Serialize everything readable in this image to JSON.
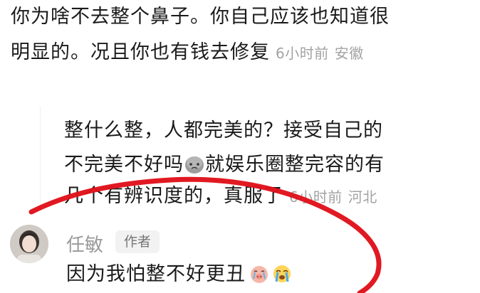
{
  "comment1": {
    "line1": "你为啥不去整个鼻子。你自己应该也知道很",
    "line2": "明显的。况且你也有钱去修复",
    "time": "6小时前",
    "location": "安徽"
  },
  "comment2": {
    "line1": "整什么整，人都完美的？接受自己的",
    "line2a": "不完美不好吗",
    "line2b": "就娱乐圈整完容的有",
    "line3": "几个有辨识度的，真服了",
    "time": "6小时前",
    "location": "河北"
  },
  "comment3": {
    "author": "任敏",
    "badge": "作者",
    "text": "因为我怕整不好更丑"
  },
  "icons": {
    "comment2_emoji": "sad-face-emoji",
    "comment3_emoji1": "crying-pig-emoji",
    "comment3_emoji2": "crying-face-emoji"
  },
  "colors": {
    "annotation_stroke": "#e0121b",
    "meta_text": "#a3a3a3",
    "badge_bg": "#f2f2f2"
  }
}
